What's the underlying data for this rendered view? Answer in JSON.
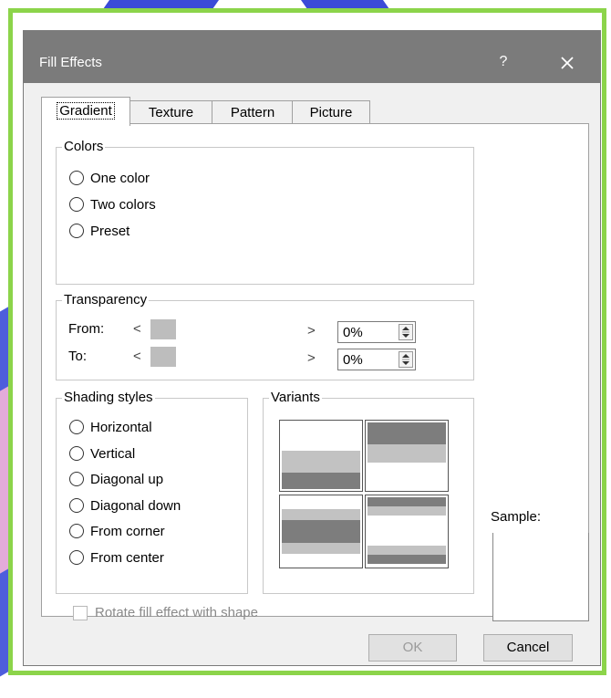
{
  "window": {
    "title": "Fill Effects",
    "help_glyph": "?",
    "close_icon": "close-icon"
  },
  "tabs": [
    {
      "label": "Gradient",
      "active": true
    },
    {
      "label": "Texture",
      "active": false
    },
    {
      "label": "Pattern",
      "active": false
    },
    {
      "label": "Picture",
      "active": false
    }
  ],
  "colors_group": {
    "legend": "Colors",
    "options": [
      "One color",
      "Two colors",
      "Preset"
    ]
  },
  "transparency_group": {
    "legend": "Transparency",
    "from_label": "From:",
    "to_label": "To:",
    "left_arrow": "<",
    "right_arrow": ">",
    "from_value": "0%",
    "to_value": "0%"
  },
  "shading_group": {
    "legend": "Shading styles",
    "options": [
      "Horizontal",
      "Vertical",
      "Diagonal up",
      "Diagonal down",
      "From corner",
      "From center"
    ]
  },
  "variants_group": {
    "legend": "Variants"
  },
  "sample": {
    "label": "Sample:"
  },
  "rotate": {
    "label": "Rotate fill effect with shape",
    "checked": false,
    "enabled": false
  },
  "buttons": {
    "ok": "OK",
    "cancel": "Cancel"
  },
  "colors": {
    "frame": "#8cd44a",
    "titlebar": "#7b7b7b",
    "swatch": "#bdbdbd",
    "band_dark": "#7d7d7d",
    "band_light": "#c2c2c2"
  }
}
